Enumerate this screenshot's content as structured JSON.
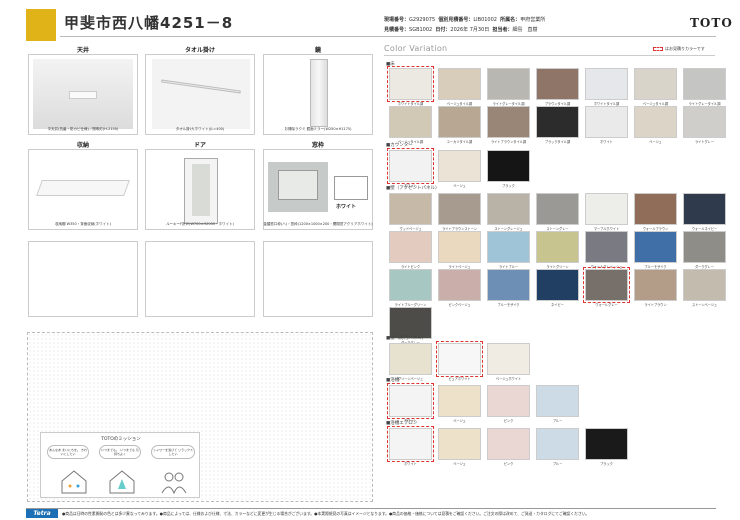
{
  "header": {
    "title": "甲斐市西八幡4251－8",
    "row1": [
      {
        "label": "現場番号：",
        "value": "G2929075"
      },
      {
        "label": "個別見積番号：",
        "value": "LIB01002"
      },
      {
        "label": "所属名：",
        "value": "甲府営業所"
      }
    ],
    "row2": [
      {
        "label": "見積番号：",
        "value": "SGB1002"
      },
      {
        "label": "日付：",
        "value": "2026年 7月30日"
      },
      {
        "label": "担当者：",
        "value": "細島　直樹"
      }
    ],
    "brand": "TOTO"
  },
  "items": [
    {
      "label": "天井",
      "caption": "平天井(抗菌・防カビ仕様)／照明灯(H-2150)"
    },
    {
      "label": "タオル掛け",
      "caption": "タオル掛け(ホワイト)(L=400)"
    },
    {
      "label": "鏡",
      "caption": "お掃除ラクミ 鏡面ミラー(W250×H1175)"
    },
    {
      "label": "収納",
      "caption": "収納棚 W350・背面収納(ホワイト)"
    },
    {
      "label": "ドア",
      "caption": "ルーキーF折戸(W700×H2000・ホワイト)"
    },
    {
      "label": "窓枠",
      "caption": "金額窓口枠(ハ)・窓枠(1200×1000×200・開閉窓アクリアホワイト)",
      "badge": "ホワイト"
    }
  ],
  "color_variation": {
    "title": "Color Variation",
    "note": "はお見積りカラーです",
    "sections": [
      {
        "name": "床",
        "swatches": [
          {
            "name": "ホワイトタイル調",
            "color": "#ece8e2",
            "sel": true
          },
          {
            "name": "ベージュタイル調",
            "color": "#d8ccbb"
          },
          {
            "name": "ライトグレータイル調",
            "color": "#b9b7b2"
          },
          {
            "name": "ブラウンタイル調",
            "color": "#8e7568"
          },
          {
            "name": "ホワイトタイル調",
            "color": "#e6e7ea"
          },
          {
            "name": "ベージュタイル調",
            "color": "#d9d4ca"
          },
          {
            "name": "ライトグレータイル調",
            "color": "#c5c5c3"
          },
          {
            "name": "ベージュタイル調",
            "color": "#d2c8b6"
          },
          {
            "name": "ユーカリタイル調",
            "color": "#b7a793"
          },
          {
            "name": "ライトブラウンタイル調",
            "color": "#9a8676"
          },
          {
            "name": "ブラックタイル調",
            "color": "#2d2c2c"
          },
          {
            "name": "ホワイト",
            "color": "#eaeaea"
          },
          {
            "name": "ベージュ",
            "color": "#dcd4c6"
          },
          {
            "name": "ライトグレー",
            "color": "#cfcecb"
          }
        ]
      },
      {
        "name": "カウンター",
        "swatches": [
          {
            "name": "ホワイト",
            "color": "#f2f2f2",
            "sel": true
          },
          {
            "name": "ベージュ",
            "color": "#ebe3d6"
          },
          {
            "name": "ブラック",
            "color": "#151515"
          }
        ]
      },
      {
        "name": "壁（アクセントパネル）",
        "swatches": [
          {
            "name": "ウッドベージュ",
            "color": "#c7b9a7"
          },
          {
            "name": "ライトブラウンストーン",
            "color": "#a79b8f"
          },
          {
            "name": "ストーングレージュ",
            "color": "#b9b3a7"
          },
          {
            "name": "ストーングレー",
            "color": "#9a9996"
          },
          {
            "name": "マーブルホワイト",
            "color": "#ededea"
          },
          {
            "name": "ウォールブラウン",
            "color": "#8f6d58"
          },
          {
            "name": "ウォールネイビー",
            "color": "#2f3a4d"
          },
          {
            "name": "ライトピンク",
            "color": "#e3cbc0"
          },
          {
            "name": "ライトベージュ",
            "color": "#ead9bf"
          },
          {
            "name": "ライトブルー",
            "color": "#9fc4d8"
          },
          {
            "name": "ライトグリーン",
            "color": "#c7c48f"
          },
          {
            "name": "ウォールグレイッシュ",
            "color": "#7a7a82"
          },
          {
            "name": "ブルーモザイク",
            "color": "#3f6fa6"
          },
          {
            "name": "ダークグレー",
            "color": "#8f8d87"
          },
          {
            "name": "ライトブルーグリーン",
            "color": "#a7c8c2"
          },
          {
            "name": "ピンクベージュ",
            "color": "#c9aeaa"
          },
          {
            "name": "ブルーモザイク",
            "color": "#6d8fb6"
          },
          {
            "name": "ネイビー",
            "color": "#213e63"
          },
          {
            "name": "ウォールグレー",
            "color": "#77706a",
            "sel": true
          },
          {
            "name": "ライトブラウン",
            "color": "#b39d89"
          },
          {
            "name": "ストーンベージュ",
            "color": "#c3bcae"
          },
          {
            "name": "ダークグレー",
            "color": "#4d4c48"
          }
        ]
      },
      {
        "name": "壁（防汚パネル）",
        "swatches": [
          {
            "name": "グリーンベージュ",
            "color": "#e7e2cf"
          },
          {
            "name": "ピュアホワイト",
            "color": "#f7f7f7",
            "sel": true
          },
          {
            "name": "ベージュホワイト",
            "color": "#f0ece3"
          }
        ]
      },
      {
        "name": "浴槽",
        "swatches": [
          {
            "name": "ホワイト",
            "color": "#f4f4f4",
            "sel": true
          },
          {
            "name": "ベージュ",
            "color": "#ede1c9"
          },
          {
            "name": "ピンク",
            "color": "#ead6d2"
          },
          {
            "name": "ブルー",
            "color": "#cddbe7"
          }
        ]
      },
      {
        "name": "浴槽エプロン",
        "swatches": [
          {
            "name": "ホワイト",
            "color": "#f4f4f4",
            "sel": true
          },
          {
            "name": "ベージュ",
            "color": "#ede1c9"
          },
          {
            "name": "ピンク",
            "color": "#ead6d2"
          },
          {
            "name": "ブルー",
            "color": "#cddbe7"
          },
          {
            "name": "ブラック",
            "color": "#1a1a1a"
          }
        ]
      }
    ]
  },
  "mission": {
    "title": "TOTOのミッション",
    "bubbles": [
      "あんなあ まいにちを。 きれいにしたい",
      "いつまでも。 いつまでも 気持ちよく",
      "シャワーを浴びて リラックス したい"
    ]
  },
  "footer": {
    "brand": "Tetra",
    "text": "●商品は日時の性素開発の色とは多少異なってみります。●商品によっては、仕様および仕様、寸法、カラーなどに変更が生じる場合がございます。●本実際規見の写真はイメージとなります。●商品の価格・価格については見積をご確認ください。ご注文の際は改めて、ご発送・カタログにてご確認ください。"
  }
}
